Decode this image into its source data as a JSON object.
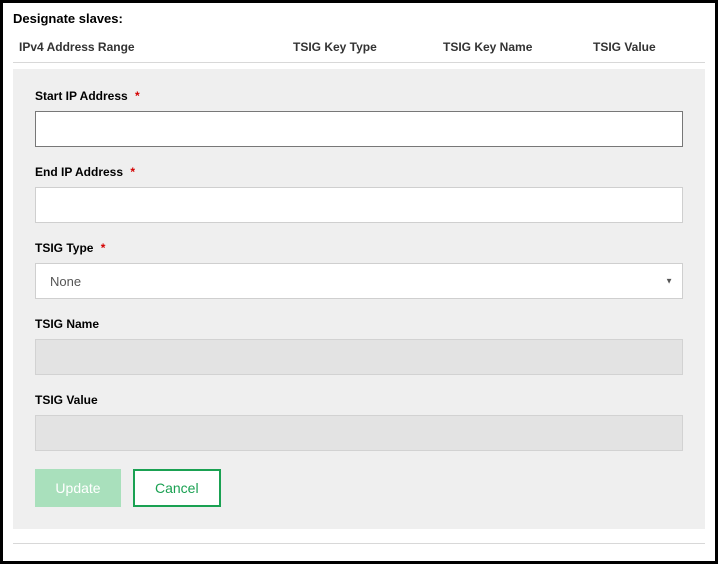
{
  "section_title": "Designate slaves:",
  "headers": {
    "ip_range": "IPv4 Address Range",
    "key_type": "TSIG Key Type",
    "key_name": "TSIG Key Name",
    "value": "TSIG Value"
  },
  "fields": {
    "start_ip": {
      "label": "Start IP Address",
      "required": "*",
      "value": ""
    },
    "end_ip": {
      "label": "End IP Address",
      "required": "*",
      "value": ""
    },
    "tsig_type": {
      "label": "TSIG Type",
      "required": "*",
      "selected": "None"
    },
    "tsig_name": {
      "label": "TSIG Name",
      "value": ""
    },
    "tsig_value": {
      "label": "TSIG Value",
      "value": ""
    }
  },
  "buttons": {
    "update": "Update",
    "cancel": "Cancel"
  }
}
